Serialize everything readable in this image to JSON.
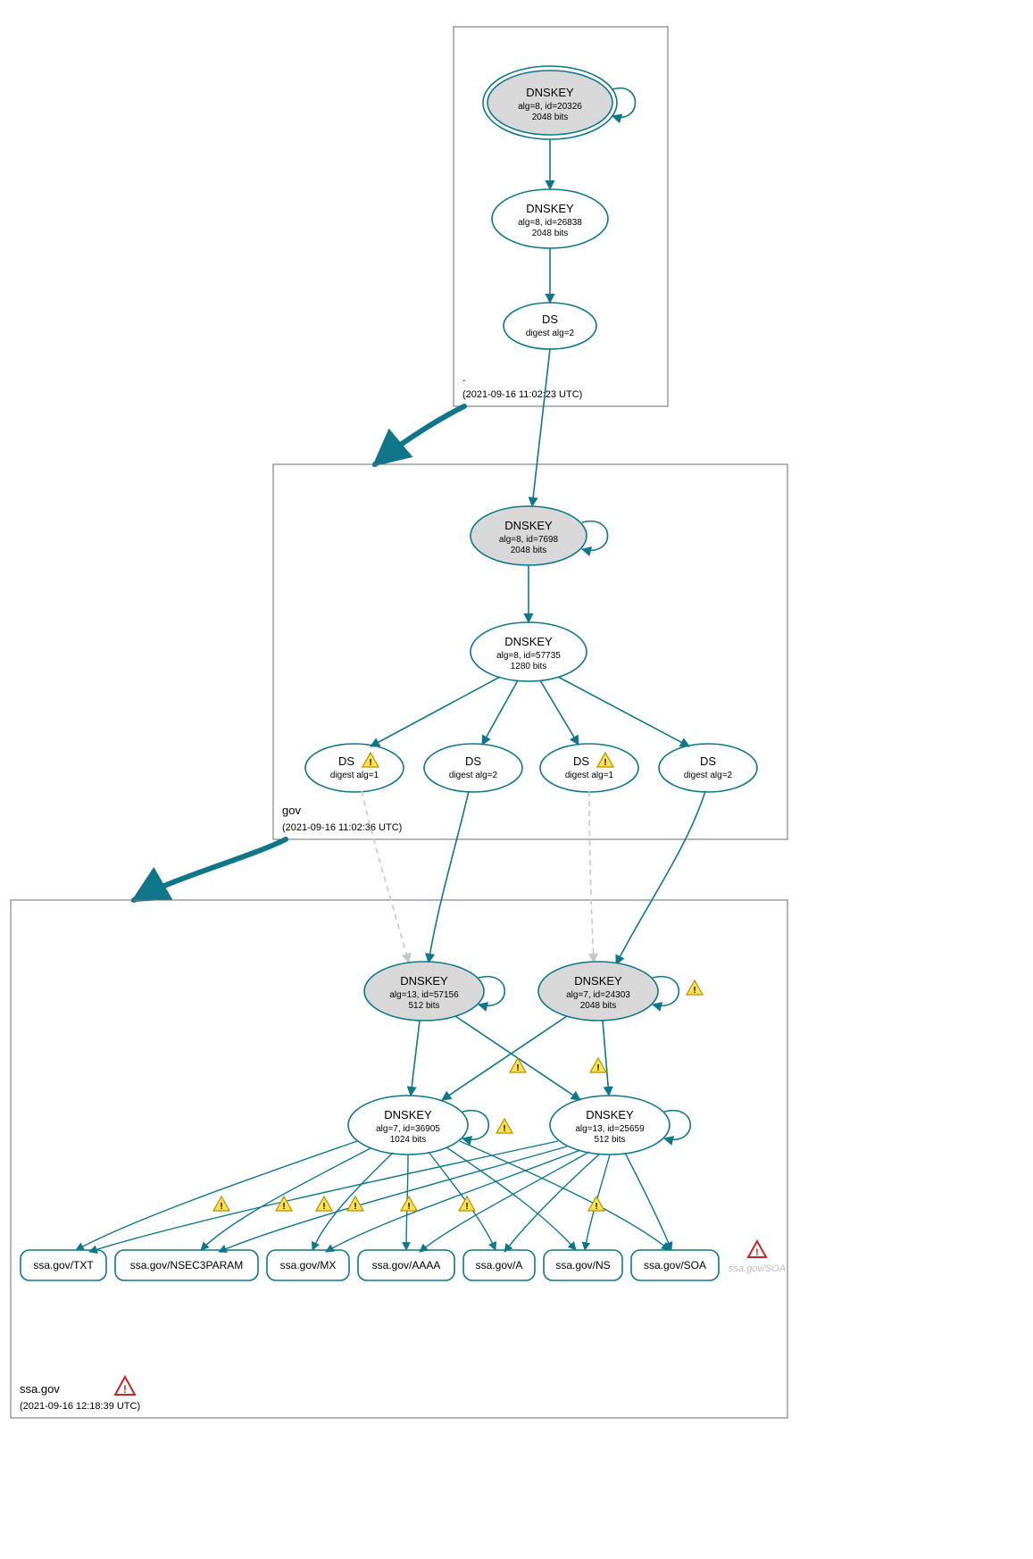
{
  "colors": {
    "stroke": "#10778a",
    "fill_grey": "#d8d8d8",
    "fill_white": "#ffffff",
    "zone_border": "#6b6b6b",
    "dashed": "#c7c7c7",
    "warn_fill": "#ffe24d",
    "warn_stroke": "#b38f00",
    "err_fill": "#ffffff",
    "err_stroke": "#c62828",
    "ghost": "#bdbdbd"
  },
  "zones": {
    "root": {
      "label": ".",
      "timestamp": "(2021-09-16 11:02:23 UTC)"
    },
    "gov": {
      "label": "gov",
      "timestamp": "(2021-09-16 11:02:36 UTC)"
    },
    "ssa": {
      "label": "ssa.gov",
      "timestamp": "(2021-09-16 12:18:39 UTC)"
    }
  },
  "nodes": {
    "root_ksk": {
      "title": "DNSKEY",
      "line2": "alg=8, id=20326",
      "line3": "2048 bits"
    },
    "root_zsk": {
      "title": "DNSKEY",
      "line2": "alg=8, id=26838",
      "line3": "2048 bits"
    },
    "root_ds": {
      "title": "DS",
      "line2": "digest alg=2"
    },
    "gov_ksk": {
      "title": "DNSKEY",
      "line2": "alg=8, id=7698",
      "line3": "2048 bits"
    },
    "gov_zsk": {
      "title": "DNSKEY",
      "line2": "alg=8, id=57735",
      "line3": "1280 bits"
    },
    "gov_ds1": {
      "title": "DS",
      "line2": "digest alg=1"
    },
    "gov_ds2": {
      "title": "DS",
      "line2": "digest alg=2"
    },
    "gov_ds3": {
      "title": "DS",
      "line2": "digest alg=1"
    },
    "gov_ds4": {
      "title": "DS",
      "line2": "digest alg=2"
    },
    "ssa_ksk1": {
      "title": "DNSKEY",
      "line2": "alg=13, id=57156",
      "line3": "512 bits"
    },
    "ssa_ksk2": {
      "title": "DNSKEY",
      "line2": "alg=7, id=24303",
      "line3": "2048 bits"
    },
    "ssa_zsk1": {
      "title": "DNSKEY",
      "line2": "alg=7, id=36905",
      "line3": "1024 bits"
    },
    "ssa_zsk2": {
      "title": "DNSKEY",
      "line2": "alg=13, id=25659",
      "line3": "512 bits"
    }
  },
  "leaves": {
    "txt": "ssa.gov/TXT",
    "nsec3": "ssa.gov/NSEC3PARAM",
    "mx": "ssa.gov/MX",
    "aaaa": "ssa.gov/AAAA",
    "a": "ssa.gov/A",
    "ns": "ssa.gov/NS",
    "soa": "ssa.gov/SOA",
    "soa_ghost": "ssa.gov/SOA"
  }
}
